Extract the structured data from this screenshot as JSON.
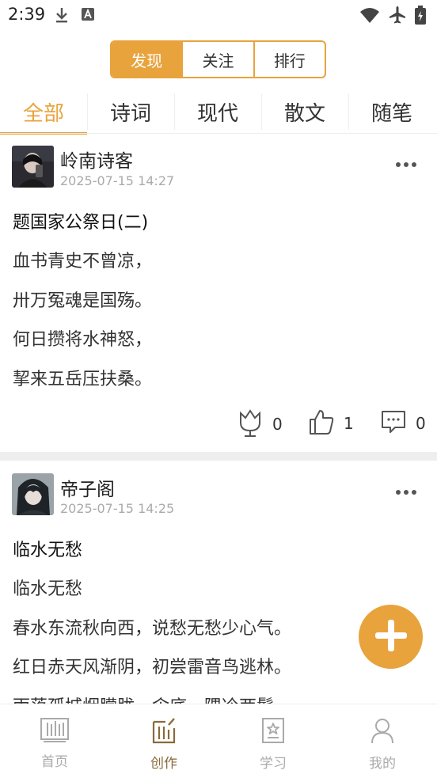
{
  "status_bar": {
    "time": "2:39",
    "icons": [
      "download-icon",
      "a-badge-icon",
      "wifi-icon",
      "airplane-icon",
      "battery-icon"
    ]
  },
  "segment": {
    "items": [
      "发现",
      "关注",
      "排行"
    ],
    "active": 0
  },
  "categories": {
    "items": [
      "全部",
      "诗词",
      "现代",
      "散文",
      "随笔"
    ],
    "active": 0
  },
  "posts": [
    {
      "author": "岭南诗客",
      "time": "2025-07-15 14:27",
      "title": "题国家公祭日(二)",
      "lines": [
        "血书青史不曾凉，",
        "卅万冤魂是国殇。",
        "何日攒将水神怒，",
        "挈来五岳压扶桑。"
      ],
      "flowers": "0",
      "likes": "1",
      "comments": "0"
    },
    {
      "author": "帝子阁",
      "time": "2025-07-15 14:25",
      "title": "临水无愁",
      "lines": [
        "临水无愁",
        "春水东流秋向西，说愁无愁少心气。",
        "红日赤天风渐阴，初尝雷音鸟逃林。",
        "雨落孤城烟朦胧，伞底一隅冷两鬓。"
      ]
    }
  ],
  "bottom_nav": {
    "items": [
      "首页",
      "创作",
      "学习",
      "我的"
    ],
    "active": 1
  },
  "colors": {
    "accent": "#e8a33d",
    "nav_active": "#8a6a3a",
    "muted": "#aaaaaa"
  }
}
